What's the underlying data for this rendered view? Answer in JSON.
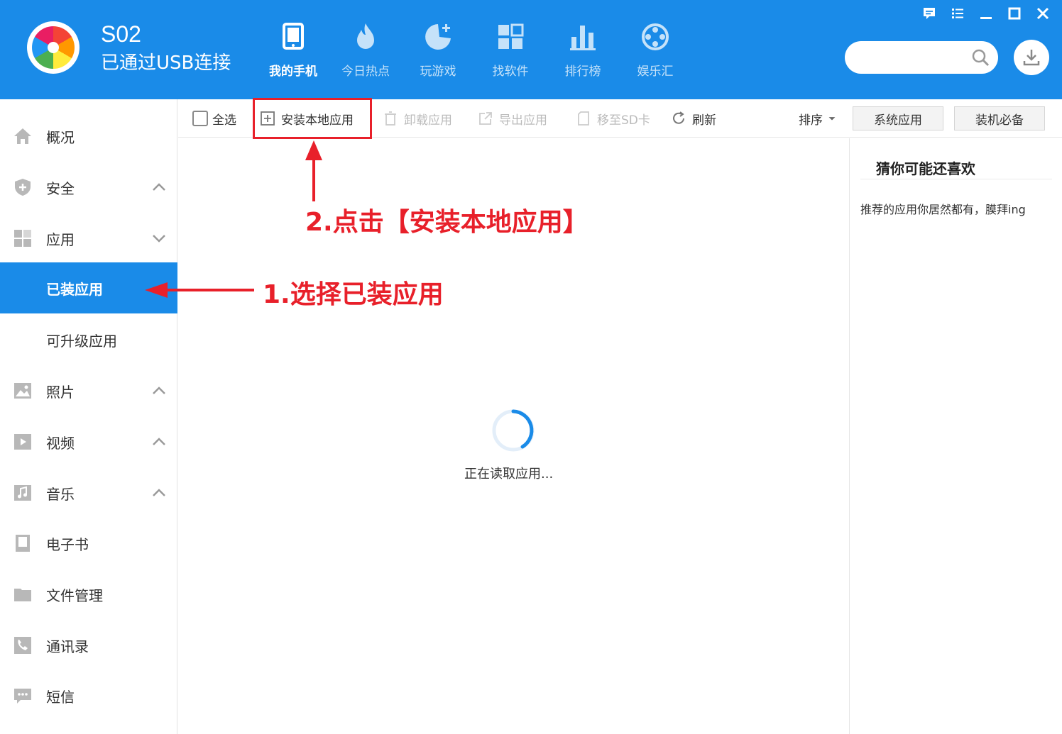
{
  "header": {
    "device_name": "S02",
    "device_status": "已通过USB连接",
    "nav": [
      {
        "label": "我的手机",
        "icon": "phone-icon",
        "active": true
      },
      {
        "label": "今日热点",
        "icon": "fire-icon",
        "active": false
      },
      {
        "label": "玩游戏",
        "icon": "game-icon",
        "active": false
      },
      {
        "label": "找软件",
        "icon": "apps-grid-icon",
        "active": false
      },
      {
        "label": "排行榜",
        "icon": "bar-chart-icon",
        "active": false
      },
      {
        "label": "娱乐汇",
        "icon": "film-reel-icon",
        "active": false
      }
    ],
    "search_placeholder": "",
    "window_controls": [
      "feedback-icon",
      "menu-list-icon",
      "minimize-icon",
      "maximize-icon",
      "close-icon"
    ]
  },
  "sidebar": {
    "items": [
      {
        "label": "概况",
        "icon": "home-icon"
      },
      {
        "label": "安全",
        "icon": "shield-icon",
        "chevron": "up"
      },
      {
        "label": "应用",
        "icon": "apps-icon",
        "chevron": "down"
      },
      {
        "label": "已装应用",
        "active": true
      },
      {
        "label": "可升级应用"
      },
      {
        "label": "照片",
        "icon": "image-icon",
        "chevron": "up"
      },
      {
        "label": "视频",
        "icon": "video-icon",
        "chevron": "up"
      },
      {
        "label": "音乐",
        "icon": "music-icon",
        "chevron": "up"
      },
      {
        "label": "电子书",
        "icon": "book-icon"
      },
      {
        "label": "文件管理",
        "icon": "folder-icon"
      },
      {
        "label": "通讯录",
        "icon": "contacts-icon"
      },
      {
        "label": "短信",
        "icon": "sms-icon"
      }
    ]
  },
  "toolbar": {
    "select_all": "全选",
    "install_local": "安装本地应用",
    "uninstall": "卸载应用",
    "export": "导出应用",
    "move_sd": "移至SD卡",
    "refresh": "刷新",
    "sort": "排序",
    "system_apps": "系统应用",
    "essentials": "装机必备"
  },
  "content": {
    "loading": "正在读取应用..."
  },
  "right_panel": {
    "title": "猜你可能还喜欢",
    "text": "推荐的应用你居然都有，膜拜ing"
  },
  "annotations": {
    "step1": "1.选择已装应用",
    "step2": "2.点击【安装本地应用】"
  },
  "colors": {
    "brand": "#1a8be8",
    "annotation": "#e8202a"
  }
}
